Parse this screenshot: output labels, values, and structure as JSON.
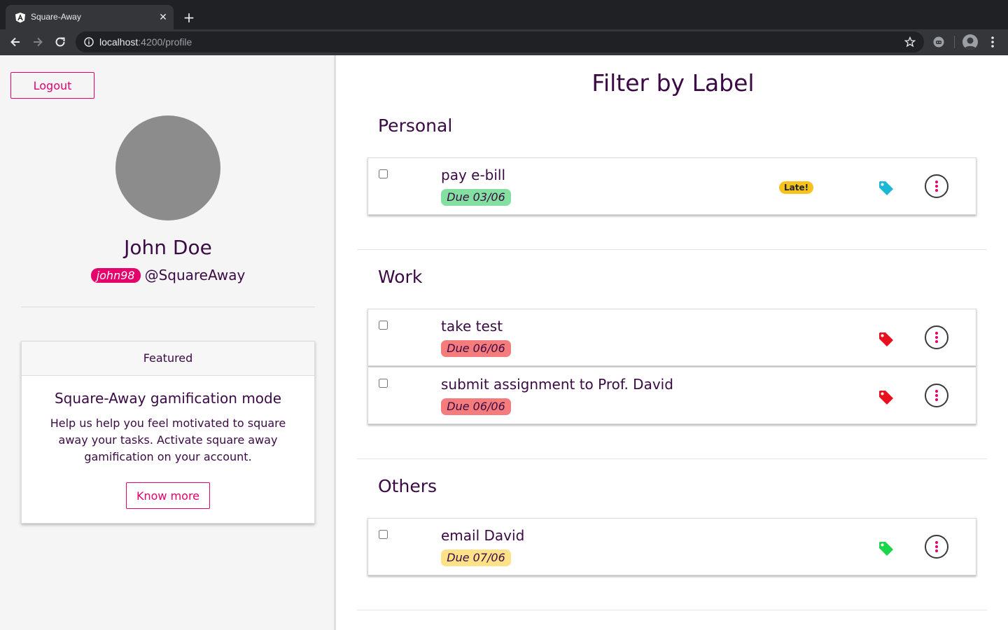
{
  "browser": {
    "tab_title": "Square-Away",
    "tab_close": "✕",
    "new_tab": "+",
    "url_host": "localhost",
    "url_path": ":4200/profile"
  },
  "sidebar": {
    "logout_label": "Logout",
    "user_name": "John Doe",
    "username_badge": "john98",
    "handle": "@SquareAway",
    "card": {
      "header": "Featured",
      "title": "Square-Away gamification mode",
      "text": "Help us help you feel motivated to square away your tasks. Activate square away gamification on your account.",
      "button_label": "Know more"
    }
  },
  "main": {
    "title": "Filter by Label",
    "sections": [
      {
        "name": "Personal",
        "tasks": [
          {
            "title": "pay e-bill",
            "due": "Due 03/06",
            "due_color": "green",
            "late": "Late!",
            "tag_color": "#1bb8d6"
          }
        ]
      },
      {
        "name": "Work",
        "tasks": [
          {
            "title": "take test",
            "due": "Due 06/06",
            "due_color": "red",
            "tag_color": "#e8101f"
          },
          {
            "title": "submit assignment to Prof. David",
            "due": "Due 06/06",
            "due_color": "red",
            "tag_color": "#e8101f"
          }
        ]
      },
      {
        "name": "Others",
        "tasks": [
          {
            "title": "email David",
            "due": "Due 07/06",
            "due_color": "yellow",
            "tag_color": "#19d64a"
          }
        ]
      }
    ]
  },
  "colors": {
    "accent": "#e5006b",
    "text": "#3b0a45",
    "due_green": "#84e0a0",
    "due_red": "#f47c7c",
    "due_yellow": "#fde28a",
    "late": "#f7c21b"
  }
}
